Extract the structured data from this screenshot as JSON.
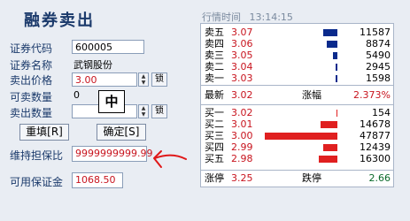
{
  "form": {
    "title": "融券卖出",
    "code_label": "证券代码",
    "code_value": "600005",
    "name_label": "证券名称",
    "name_value": "武钢股份",
    "price_label": "卖出价格",
    "price_value": "3.00",
    "lock_label": "锁",
    "avail_label": "可卖数量",
    "avail_value": "0",
    "qty_label": "卖出数量",
    "qty_value": "",
    "reset_button": "重填[R]",
    "confirm_button": "确定[S]",
    "ime_char": "中",
    "margin_ratio_label": "维持担保比",
    "margin_ratio_value": "9999999999.99",
    "available_margin_label": "可用保证金",
    "available_margin_value": "1068.50"
  },
  "quotes": {
    "header_label": "行情时间",
    "time": "13:14:15",
    "sells": [
      {
        "name": "卖五",
        "price": "3.07",
        "volume": "11587",
        "bar": 0.19
      },
      {
        "name": "卖四",
        "price": "3.06",
        "volume": "8874",
        "bar": 0.15
      },
      {
        "name": "卖三",
        "price": "3.05",
        "volume": "5490",
        "bar": 0.06
      },
      {
        "name": "卖二",
        "price": "3.04",
        "volume": "2945",
        "bar": 0.03
      },
      {
        "name": "卖一",
        "price": "3.03",
        "volume": "1598",
        "bar": 0.02
      }
    ],
    "latest_label": "最新",
    "latest_price": "3.02",
    "change_label": "涨幅",
    "change_value": "2.373%",
    "buys": [
      {
        "name": "买一",
        "price": "3.02",
        "volume": "154",
        "bar": 0.0
      },
      {
        "name": "买二",
        "price": "3.01",
        "volume": "14678",
        "bar": 0.23
      },
      {
        "name": "买三",
        "price": "3.00",
        "volume": "47877",
        "bar": 1.0
      },
      {
        "name": "买四",
        "price": "2.99",
        "volume": "12439",
        "bar": 0.2
      },
      {
        "name": "买五",
        "price": "2.98",
        "volume": "16300",
        "bar": 0.26
      }
    ],
    "limit_up_label": "涨停",
    "limit_up_value": "3.25",
    "limit_down_label": "跌停",
    "limit_down_value": "2.66"
  },
  "colors": {
    "sell_bar": "#0a2a8c",
    "buy_bar": "#e02020",
    "price_red": "#c8141e",
    "annotation": "#e01818"
  }
}
